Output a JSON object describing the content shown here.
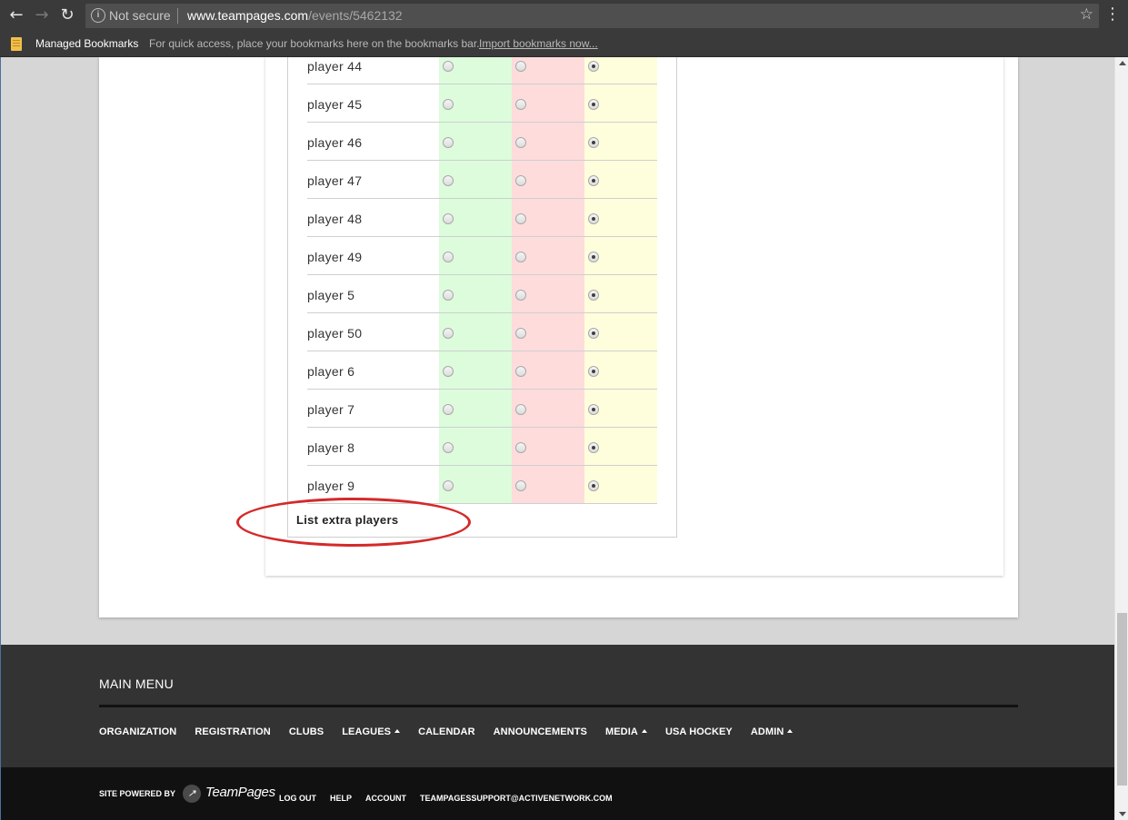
{
  "browser": {
    "security_label": "Not secure",
    "url_host": "www.teampages.com",
    "url_path": "/events/5462132",
    "back_icon": "arrow-left-icon",
    "forward_icon": "arrow-right-icon",
    "reload_icon": "reload-icon",
    "star_icon": "star-icon",
    "menu_icon": "kebab-menu-icon"
  },
  "bookmarks": {
    "managed_label": "Managed Bookmarks",
    "hint_text": "For quick access, place your bookmarks here on the bookmarks bar.",
    "import_label": "Import bookmarks now..."
  },
  "rsvp": {
    "column_colors": {
      "yes": "#dcfcdc",
      "no": "#fedcdc",
      "maybe": "#fefedc"
    },
    "players": [
      {
        "name": "player 44",
        "status": "maybe"
      },
      {
        "name": "player 45",
        "status": "maybe"
      },
      {
        "name": "player 46",
        "status": "maybe"
      },
      {
        "name": "player 47",
        "status": "maybe"
      },
      {
        "name": "player 48",
        "status": "maybe"
      },
      {
        "name": "player 49",
        "status": "maybe"
      },
      {
        "name": "player 5",
        "status": "maybe"
      },
      {
        "name": "player 50",
        "status": "maybe"
      },
      {
        "name": "player 6",
        "status": "maybe"
      },
      {
        "name": "player 7",
        "status": "maybe"
      },
      {
        "name": "player 8",
        "status": "maybe"
      },
      {
        "name": "player 9",
        "status": "maybe"
      }
    ],
    "extra_players_label": "List extra players",
    "annotation_color": "#d42a2a"
  },
  "footer": {
    "menu_title": "MAIN MENU",
    "menu_items": [
      {
        "label": "ORGANIZATION",
        "has_caret": false
      },
      {
        "label": "REGISTRATION",
        "has_caret": false
      },
      {
        "label": "CLUBS",
        "has_caret": false
      },
      {
        "label": "LEAGUES",
        "has_caret": true
      },
      {
        "label": "CALENDAR",
        "has_caret": false
      },
      {
        "label": "ANNOUNCEMENTS",
        "has_caret": false
      },
      {
        "label": "MEDIA",
        "has_caret": true
      },
      {
        "label": "USA HOCKEY",
        "has_caret": false
      },
      {
        "label": "ADMIN",
        "has_caret": true
      }
    ],
    "powered_by": "SITE POWERED BY",
    "brand_name": "TeamPages",
    "links": [
      "LOG OUT",
      "HELP",
      "ACCOUNT",
      "TEAMPAGESSUPPORT@ACTIVENETWORK.COM"
    ]
  }
}
